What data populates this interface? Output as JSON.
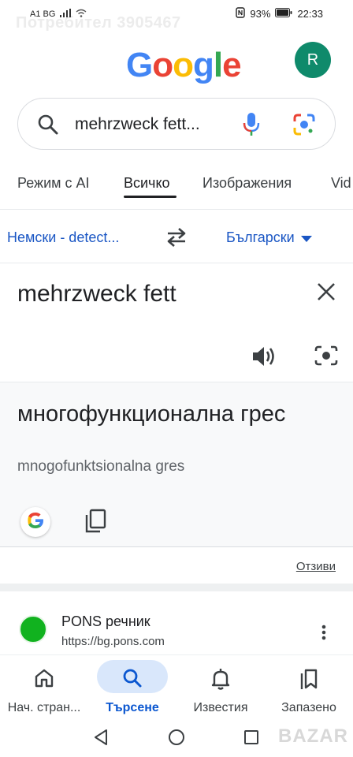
{
  "status_bar": {
    "carrier": "A1 BG",
    "battery": "93%",
    "time": "22:33"
  },
  "watermark": "Потребител 3905467",
  "header": {
    "logo_text": "Google",
    "avatar_letter": "R",
    "avatar_color": "#0f8a6b"
  },
  "search": {
    "query": "mehrzweck fett..."
  },
  "tabs": [
    {
      "label": "Режим с AI",
      "active": false
    },
    {
      "label": "Всичко",
      "active": true
    },
    {
      "label": "Изображения",
      "active": false
    },
    {
      "label": "Vid",
      "active": false
    }
  ],
  "translate": {
    "source_lang": "Немски - detect...",
    "target_lang": "Български",
    "source_text": "mehrzweck fett",
    "result_text": "многофункционална грес",
    "transliteration": "mnogofunktsionalna gres"
  },
  "feedback_link": "Отзиви",
  "results": [
    {
      "site": "PONS речник",
      "url": "https://bg.pons.com",
      "favicon_color": "#11b21f"
    }
  ],
  "bottom_nav": [
    {
      "label": "Нач. стран...",
      "icon": "home-icon",
      "active": false
    },
    {
      "label": "Търсене",
      "icon": "search-icon",
      "active": true
    },
    {
      "label": "Известия",
      "icon": "bell-icon",
      "active": false
    },
    {
      "label": "Запазено",
      "icon": "bookmarks-icon",
      "active": false
    }
  ],
  "brand_watermark": "BAZAR",
  "colors": {
    "link_blue": "#1a56c4",
    "active_blue": "#0b57d0",
    "pill_bg": "#d9e7fb"
  }
}
